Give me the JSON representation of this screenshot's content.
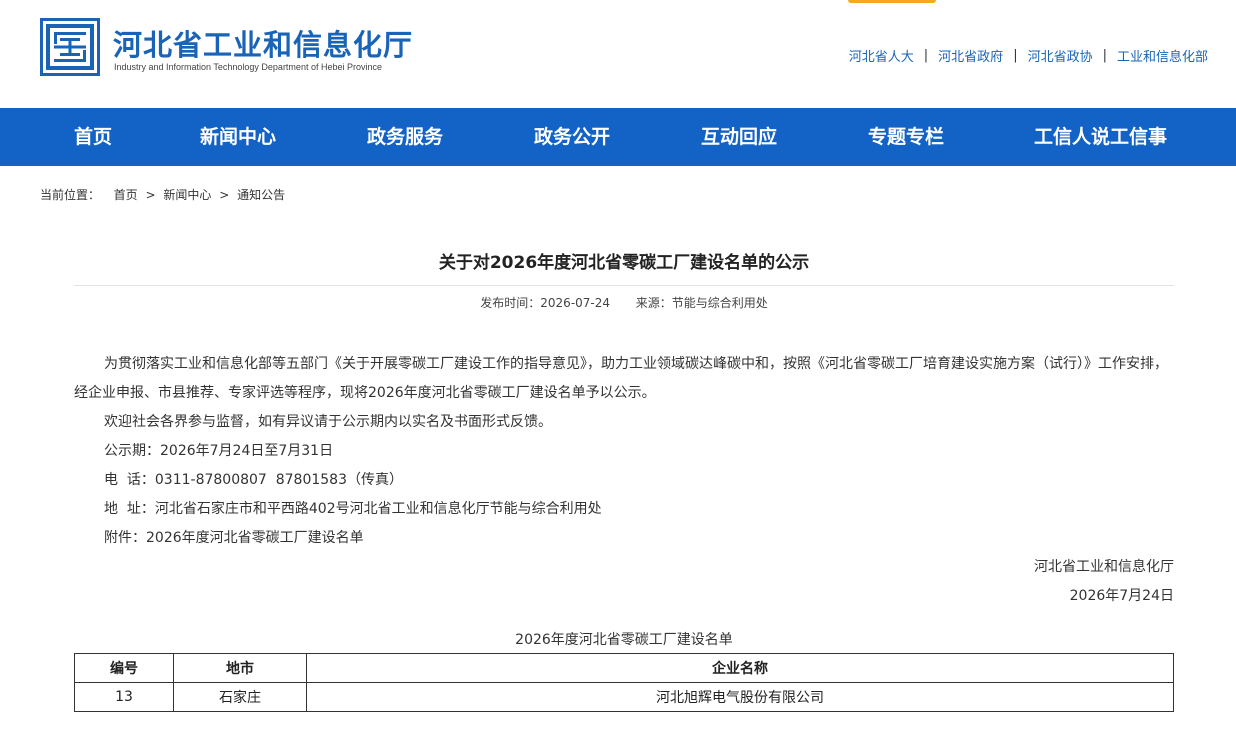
{
  "site": {
    "title": "河北省工业和信息化厅",
    "subtitle": "Industry and Information Technology Department of Hebei Province",
    "brand_color": "#1a64b8",
    "nav_color": "#1362c5",
    "accent_color": "#f4a81d"
  },
  "quick_links": [
    "河北省人大",
    "河北省政府",
    "河北省政协",
    "工业和信息化部"
  ],
  "nav": [
    "首页",
    "新闻中心",
    "政务服务",
    "政务公开",
    "互动回应",
    "专题专栏",
    "工信人说工信事"
  ],
  "breadcrumb": {
    "label": "当前位置：",
    "items": [
      "首页",
      "新闻中心",
      "通知公告"
    ],
    "sep": ">"
  },
  "article": {
    "title": "关于对2026年度河北省零碳工厂建设名单的公示",
    "publish_label": "发布时间：",
    "publish_date": "2026-07-24",
    "source_label": "来源：",
    "source": "节能与综合利用处",
    "paragraphs": [
      "为贯彻落实工业和信息化部等五部门《关于开展零碳工厂建设工作的指导意见》，助力工业领域碳达峰碳中和，按照《河北省零碳工厂培育建设实施方案（试行）》工作安排，经企业申报、市县推荐、专家评选等程序，现将2026年度河北省零碳工厂建设名单予以公示。",
      "欢迎社会各界参与监督，如有异议请于公示期内以实名及书面形式反馈。",
      "公示期：2026年7月24日至7月31日",
      "电  话：0311-87800807  87801583（传真）",
      "地  址：河北省石家庄市和平西路402号河北省工业和信息化厅节能与综合利用处",
      "附件：2026年度河北省零碳工厂建设名单"
    ],
    "signature": "河北省工业和信息化厅",
    "sign_date": "2026年7月24日"
  },
  "table": {
    "caption": "2026年度河北省零碳工厂建设名单",
    "headers": [
      "编号",
      "地市",
      "企业名称"
    ],
    "rows": [
      [
        "13",
        "石家庄",
        "河北旭辉电气股份有限公司"
      ]
    ]
  }
}
